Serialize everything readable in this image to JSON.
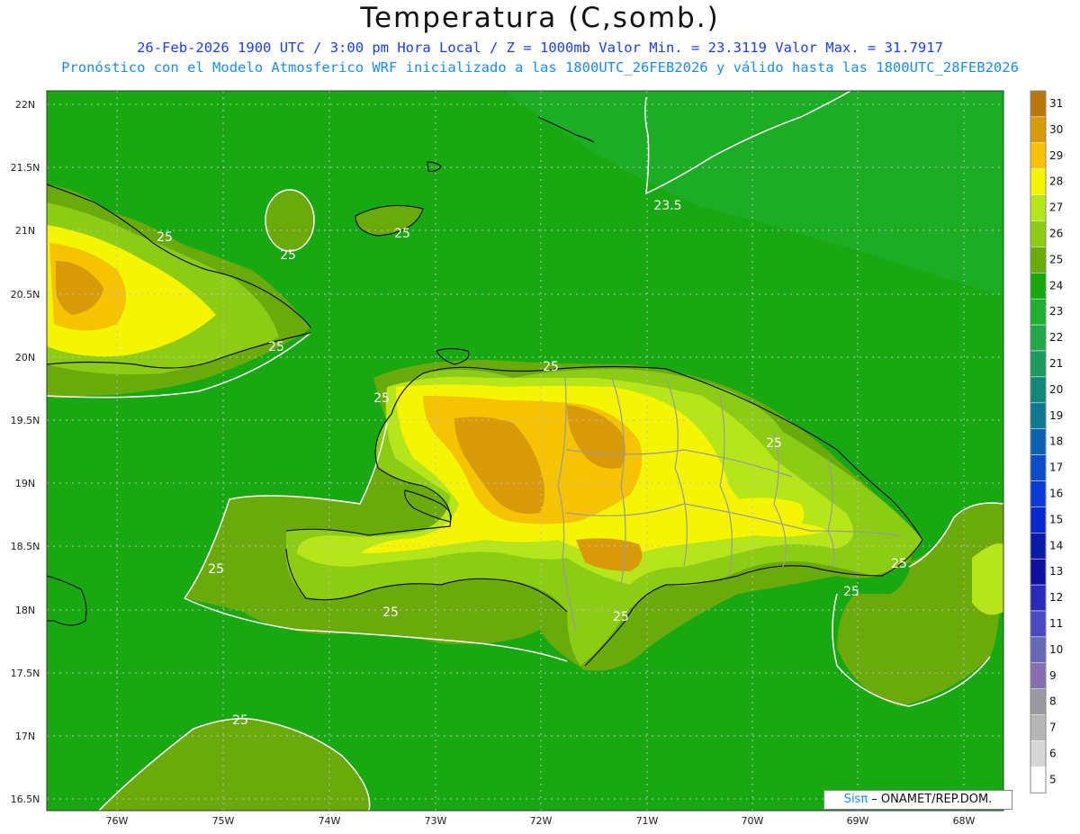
{
  "header": {
    "title": "Temperatura (C,somb.)",
    "line1": "26-Feb-2026  1900 UTC / 3:00 pm Hora Local / Z = 1000mb   Valor Min. = 23.3119  Valor Max. = 31.7917",
    "line2": "Pronóstico con el Modelo Atmosferico WRF inicializado a las 1800UTC_26FEB2026 y válido hasta las  1800UTC_28FEB2026"
  },
  "axes": {
    "lat_labels": [
      "22N",
      "21.5N",
      "21N",
      "20.5N",
      "20N",
      "19.5N",
      "19N",
      "18.5N",
      "18N",
      "17.5N",
      "17N",
      "16.5N"
    ],
    "lon_labels": [
      "76W",
      "75W",
      "74W",
      "73W",
      "72W",
      "71W",
      "70W",
      "69W",
      "68W"
    ]
  },
  "contours": {
    "labels": [
      "25",
      "25",
      "25",
      "25",
      "25",
      "25",
      "25",
      "25",
      "25",
      "25",
      "25",
      "25",
      "25",
      "25",
      "23.5"
    ]
  },
  "colorbar": {
    "labels": [
      "31",
      "30",
      "29",
      "28",
      "27",
      "26",
      "25",
      "24",
      "23",
      "22",
      "21",
      "20",
      "19",
      "18",
      "17",
      "16",
      "15",
      "14",
      "13",
      "12",
      "11",
      "10",
      "9",
      "8",
      "7",
      "6",
      "5"
    ],
    "colors": [
      "#b8780a",
      "#d89a08",
      "#f5c300",
      "#f5f500",
      "#b6e61a",
      "#8ccc14",
      "#6aaa0a",
      "#18a812",
      "#20b030",
      "#22a848",
      "#1a9a60",
      "#148878",
      "#107890",
      "#0e62b0",
      "#0c4cc8",
      "#0a3ad8",
      "#0a28d0",
      "#0c1aa8",
      "#1010a0",
      "#2a2ab8",
      "#4848c0",
      "#6868b8",
      "#8470b0",
      "#9a9aa0",
      "#b6b6b6",
      "#d6d6d6",
      "#ffffff"
    ]
  },
  "legend": {
    "credit_brand": "Sisπ",
    "credit_text": " – ONAMET/REP.DOM."
  }
}
